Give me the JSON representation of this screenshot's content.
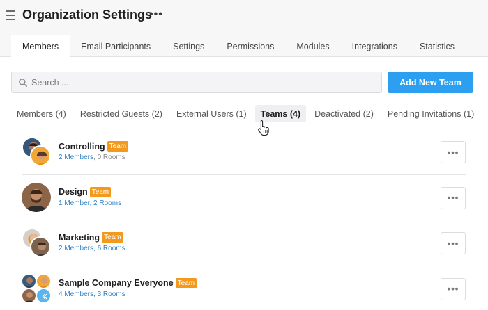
{
  "header": {
    "title": "Organization Settings",
    "more_label": "•••",
    "menu_icon": "hamburger-icon"
  },
  "tabs": [
    {
      "label": "Members",
      "active": true
    },
    {
      "label": "Email Participants",
      "active": false
    },
    {
      "label": "Settings",
      "active": false
    },
    {
      "label": "Permissions",
      "active": false
    },
    {
      "label": "Modules",
      "active": false
    },
    {
      "label": "Integrations",
      "active": false
    },
    {
      "label": "Statistics",
      "active": false
    }
  ],
  "search": {
    "placeholder": "Search ...",
    "value": "",
    "icon": "search-icon"
  },
  "add_button": {
    "label": "Add New Team",
    "color": "#2c9ff0"
  },
  "subtabs": [
    {
      "label": "Members (4)",
      "active": false
    },
    {
      "label": "Restricted Guests (2)",
      "active": false
    },
    {
      "label": "External Users (1)",
      "active": false
    },
    {
      "label": "Teams (4)",
      "active": true
    },
    {
      "label": "Deactivated (2)",
      "active": false
    },
    {
      "label": "Pending Invitations (1)",
      "active": false
    }
  ],
  "teams": [
    {
      "name": "Controlling",
      "badge": "Team",
      "members": "2 Members",
      "separator": ", ",
      "rooms": "0 Rooms",
      "menu": "•••"
    },
    {
      "name": "Design",
      "badge": "Team",
      "members": "1 Member, 2 Rooms",
      "separator": "",
      "rooms": "",
      "menu": "•••"
    },
    {
      "name": "Marketing",
      "badge": "Team",
      "members": "2 Members, 6 Rooms",
      "separator": "",
      "rooms": "",
      "menu": "•••"
    },
    {
      "name": "Sample Company Everyone",
      "badge": "Team",
      "members": "4 Members, 3 Rooms",
      "separator": "",
      "rooms": "",
      "menu": "•••"
    }
  ],
  "colors": {
    "accent": "#2c9ff0",
    "badge": "#f39a1e",
    "link": "#2d7fc4"
  }
}
